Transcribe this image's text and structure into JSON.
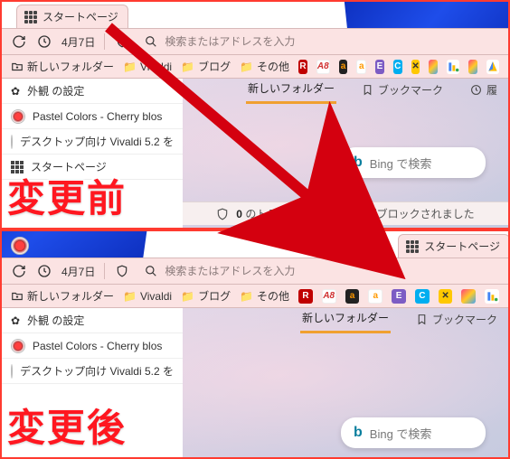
{
  "tab_label": "スタートページ",
  "toolbar": {
    "date": "4月7日",
    "placeholder": "検索またはアドレスを入力"
  },
  "bookmarks": {
    "new_folder": "新しいフォルダー",
    "vivaldi": "Vivaldi",
    "blog": "ブログ",
    "other": "その他"
  },
  "panel": {
    "settings": "外観 の設定",
    "p1": "Pastel Colors - Cherry blos",
    "p2": "デスクトップ向け Vivaldi 5.2 を",
    "p3": "スタートページ"
  },
  "nav": {
    "new_folder": "新しいフォルダー",
    "bookmark": "ブックマーク",
    "history": "履"
  },
  "bing_label": "Bing で検索",
  "tracker_template": "0 のトラッカーと 0 の広告がブロックされました",
  "labels": {
    "before": "変更前",
    "after": "変更後"
  },
  "icons": {
    "brand_R": "R",
    "brand_A8": "A8",
    "brand_a1": "a",
    "brand_a2": "a",
    "brand_E": "E",
    "brand_C": "C",
    "brand_X": "✕",
    "bing_b": "b"
  },
  "colors": {
    "accent_border": "#ff3b30",
    "arrow": "#d4000f",
    "tab_orange": "#f0a030"
  }
}
